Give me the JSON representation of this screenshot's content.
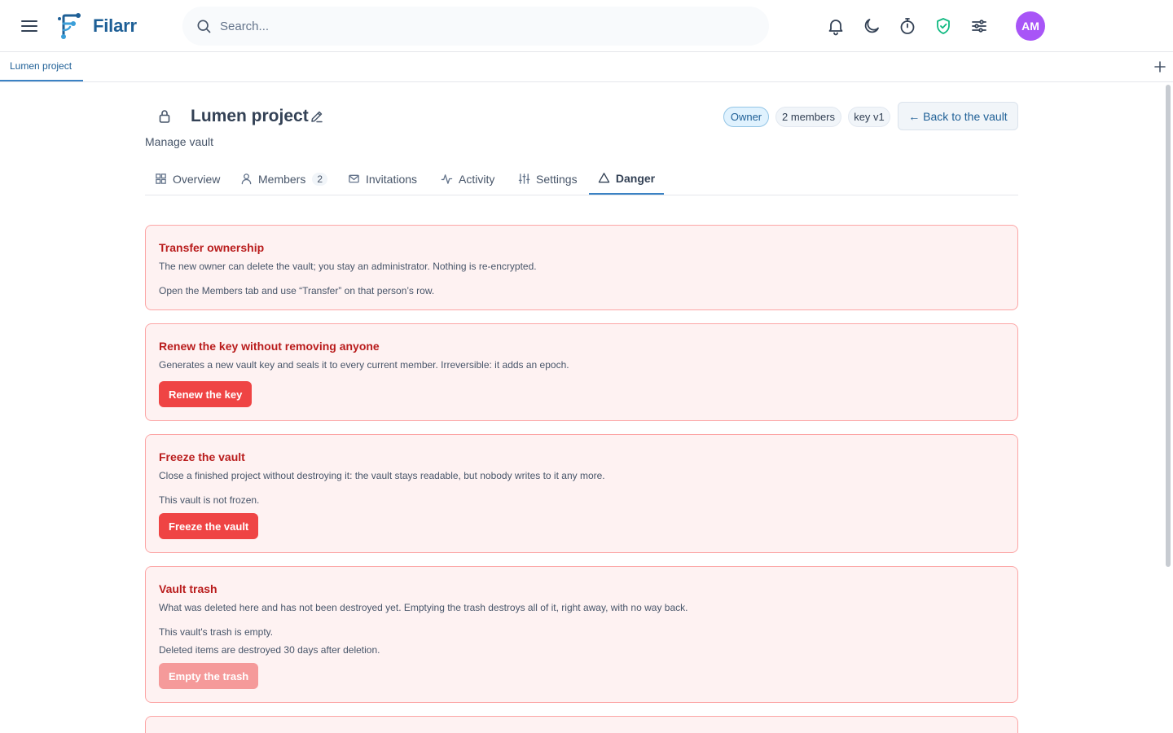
{
  "app": {
    "brand": "Filarr",
    "user_initials": "AM"
  },
  "search": {
    "placeholder": "Search..."
  },
  "doc_tabs": [
    {
      "label": "Lumen project"
    }
  ],
  "vault": {
    "title": "Lumen project",
    "subtitle": "Manage vault",
    "badges": {
      "owner": "Owner",
      "members": "2 members",
      "key": "key v1"
    },
    "back_label": "← Back to the vault"
  },
  "tabs": [
    {
      "label": "Overview"
    },
    {
      "label": "Members",
      "count": "2"
    },
    {
      "label": "Invitations"
    },
    {
      "label": "Activity"
    },
    {
      "label": "Settings"
    },
    {
      "label": "Danger"
    }
  ],
  "active_tab": "Danger",
  "cards": {
    "transfer": {
      "title": "Transfer ownership",
      "desc": "The new owner can delete the vault; you stay an administrator. Nothing is re-encrypted.",
      "note": "Open the Members tab and use “Transfer” on that person’s row."
    },
    "renew": {
      "title": "Renew the key without removing anyone",
      "desc": "Generates a new vault key and seals it to every current member. Irreversible: it adds an epoch.",
      "button": "Renew the key"
    },
    "freeze": {
      "title": "Freeze the vault",
      "desc": "Close a finished project without destroying it: the vault stays readable, but nobody writes to it any more.",
      "status": "This vault is not frozen.",
      "button": "Freeze the vault"
    },
    "trash": {
      "title": "Vault trash",
      "desc": "What was deleted here and has not been destroyed yet. Emptying the trash destroys all of it, right away, with no way back.",
      "status": "This vault's trash is empty.",
      "retention": "Deleted items are destroyed 30 days after deletion.",
      "button": "Empty the trash"
    }
  },
  "colors": {
    "accent": "#3b82c4",
    "danger": "#ef4444",
    "danger_bg": "#fef2f2",
    "avatar": "#a855f7"
  }
}
